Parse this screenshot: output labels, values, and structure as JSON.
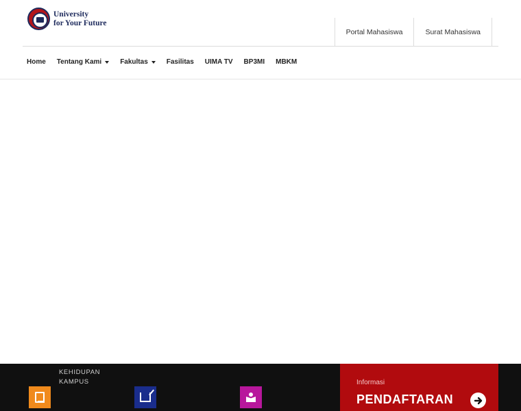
{
  "logo": {
    "line1": "University",
    "line2": "for Your Future",
    "icon": "university-seal-icon"
  },
  "top_links": [
    "Portal Mahasiswa",
    "Surat Mahasiswa"
  ],
  "nav": [
    {
      "label": "Home",
      "dropdown": false
    },
    {
      "label": "Tentang Kami",
      "dropdown": true
    },
    {
      "label": "Fakultas",
      "dropdown": true
    },
    {
      "label": "Fasilitas",
      "dropdown": false
    },
    {
      "label": "UIMA TV",
      "dropdown": false
    },
    {
      "label": "BP3MI",
      "dropdown": false
    },
    {
      "label": "MBKM",
      "dropdown": false
    }
  ],
  "footer": {
    "campus_label": "KEHIDUPAN KAMPUS",
    "tiles": [
      {
        "icon": "book-icon",
        "color": "#f08a1c"
      },
      {
        "icon": "edit-icon",
        "color": "#1a2d8c"
      },
      {
        "icon": "reader-icon",
        "color": "#b8179c"
      }
    ],
    "register": {
      "small": "Informasi",
      "big": "PENDAFTARAN",
      "icon": "arrow-right-circle-icon",
      "color": "#b10b0e"
    }
  }
}
